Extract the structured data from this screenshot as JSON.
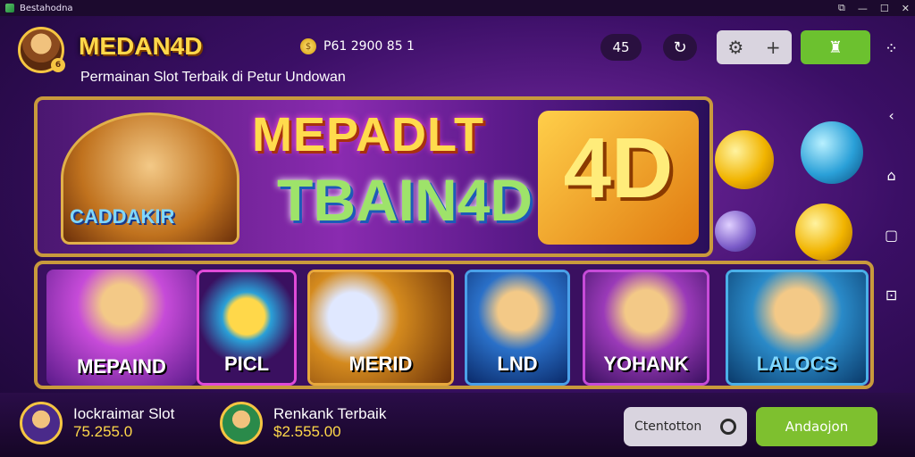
{
  "window": {
    "title": "Bestahodna",
    "controls": [
      "⧉",
      "—",
      "☐",
      "✕"
    ]
  },
  "header": {
    "brand": "MEDAN4D",
    "tagline": "Permainan Slot Terbaik di Petur Undowan",
    "balance": "P61 2900 85  1",
    "counter": "4̵̵ 5",
    "avatar_level": "6"
  },
  "banner": {
    "logo_line1": "MEPADLT",
    "logo_line2": "TBAIN4D",
    "panel_text": "4D",
    "sub_logo": "CADDAKIR"
  },
  "games": [
    {
      "label": "MEPAIND",
      "color": "#c64bd8"
    },
    {
      "label": "PICL",
      "color": "#8a2bb0"
    },
    {
      "label": "MERID",
      "color": "#d48a1e"
    },
    {
      "label": "LND",
      "color": "#2a70c8"
    },
    {
      "label": "YOHANK",
      "color": "#9a3ab8"
    },
    {
      "label": "LALOCS",
      "color": "#2a8ac8"
    }
  ],
  "footer": {
    "items": [
      {
        "title": "Iockraimar Slot",
        "value": "75.255.0"
      },
      {
        "title": "Renkank Terbaik",
        "value": "$2.555.00"
      }
    ],
    "outline_button": "Ctentotton",
    "cta_button": "Andaojon"
  },
  "icons": {
    "refresh": "refresh-icon",
    "settings": "gear-icon",
    "add": "plus-icon",
    "trophy": "trophy-icon",
    "menu": "dots-icon",
    "coin": "coin-icon",
    "back": "back-icon",
    "home": "home-icon",
    "recent": "recent-icon"
  },
  "colors": {
    "accent_green": "#6cc12f",
    "gold": "#ffd84a",
    "frame": "#c99a3c"
  }
}
